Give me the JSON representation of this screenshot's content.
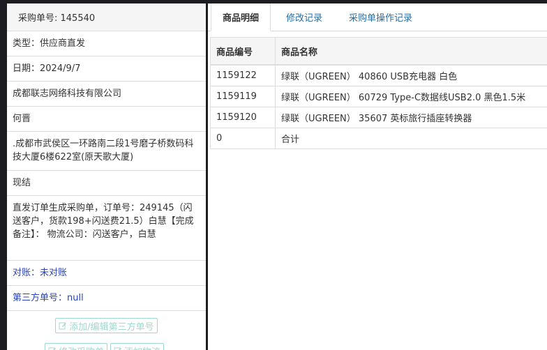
{
  "header": {
    "order_no": "采购单号: 145540"
  },
  "info": {
    "type": "类型：供应商直发",
    "date": "日期：2024/9/7",
    "company": "成都联志网络科技有限公司",
    "contact": "何晋",
    "address": ".成都市武侯区一环路南二段1号磨子桥数码科技大厦6楼622室(原天歌大厦)",
    "payment": "现结",
    "remark": "直发订单生成采购单，订单号：249145（闪送客户，货款198+闪送费21.5）白慧【完成备注】： 物流公司：闪送客户，白慧",
    "reconcile": "对账：未对账",
    "third_party": "第三方单号：null"
  },
  "buttons": {
    "add_edit_third_party": "添加/编辑第三方单号",
    "modify_order": "修改采购单",
    "add_logistics": "添加物流"
  },
  "tabs": [
    {
      "label": "商品明细"
    },
    {
      "label": "修改记录"
    },
    {
      "label": "采购单操作记录"
    }
  ],
  "table": {
    "headers": [
      "商品编号",
      "商品名称"
    ],
    "rows": [
      [
        "1159122",
        "绿联（UGREEN） 40860 USB充电器 白色"
      ],
      [
        "1159119",
        "绿联（UGREEN） 60729 Type-C数据线USB2.0 黑色1.5米"
      ],
      [
        "1159120",
        "绿联（UGREEN） 35607 英标旅行插座转换器"
      ],
      [
        "0",
        "合计"
      ]
    ]
  },
  "colors": {
    "link_blue": "#2a43b8",
    "tab_blue": "#2a6ea6",
    "button_teal": "#9fd8cf",
    "background": "#1b1d22"
  }
}
